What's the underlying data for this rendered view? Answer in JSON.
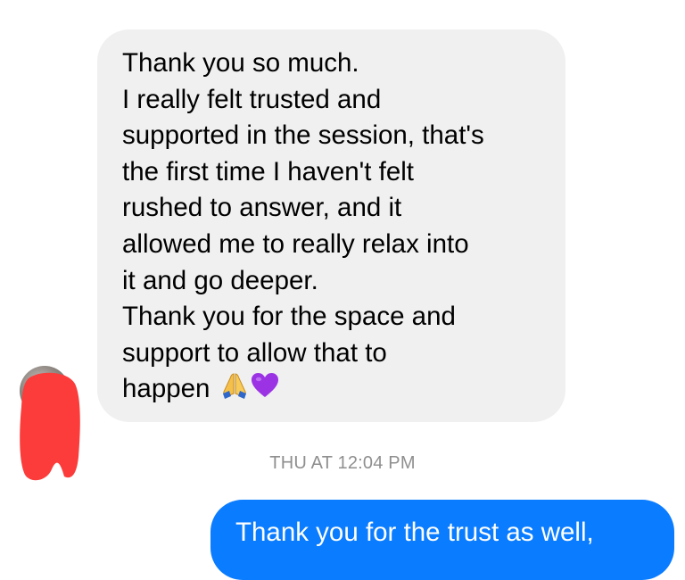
{
  "conversation": {
    "incoming_message": {
      "lines": [
        "Thank you so much.",
        "I really felt trusted and",
        "supported in the session, that's",
        "the first time I haven't felt",
        "rushed to answer, and it",
        "allowed me to really relax into",
        "it and go deeper.",
        "Thank you for the space and",
        "support to allow that to",
        "happen"
      ],
      "emojis": [
        "folded-hands-icon",
        "purple-heart-icon"
      ],
      "bubble_color": "#f0f0f0"
    },
    "timestamp": "THU AT 12:04 PM",
    "outgoing_message": {
      "lines": [
        "Thank you for the trust as well,"
      ],
      "bubble_color": "#0a7cff"
    },
    "sender_avatar": {
      "redacted": true,
      "redaction_color": "#fb3c3a"
    }
  }
}
